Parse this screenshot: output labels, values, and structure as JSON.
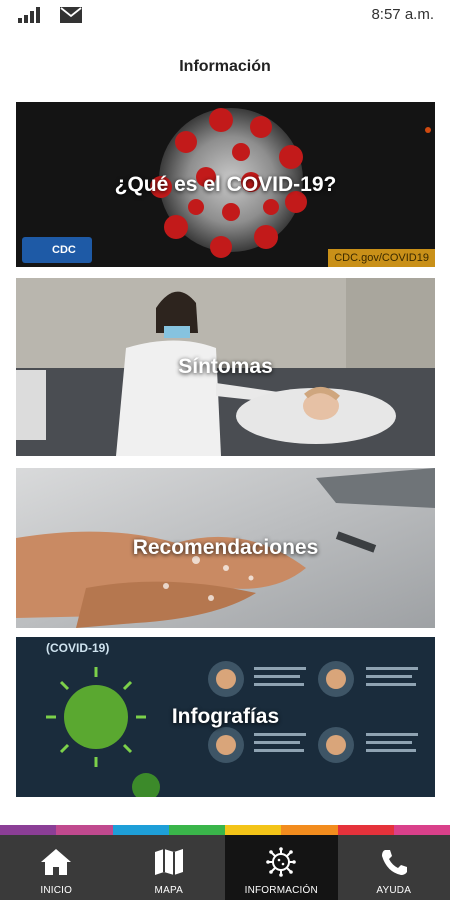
{
  "status_bar": {
    "time": "8:57 a.m."
  },
  "header": {
    "title": "Información"
  },
  "cards": [
    {
      "label": "¿Qué es el COVID-19?",
      "badge": "CDC",
      "url": "CDC.gov/COVID19"
    },
    {
      "label": "Síntomas"
    },
    {
      "label": "Recomendaciones"
    },
    {
      "label": "Infografías",
      "tag": "(COVID-19)"
    }
  ],
  "nav": {
    "strip_colors": [
      "#8b3e96",
      "#c0498e",
      "#1e9fd8",
      "#3ab54a",
      "#f3c418",
      "#f28c1e",
      "#e5323b",
      "#d9408a"
    ],
    "items": [
      {
        "label": "INICIO",
        "icon": "home-icon"
      },
      {
        "label": "MAPA",
        "icon": "map-icon"
      },
      {
        "label": "INFORMACIÓN",
        "icon": "virus-icon",
        "active": true
      },
      {
        "label": "AYUDA",
        "icon": "phone-icon"
      }
    ]
  }
}
